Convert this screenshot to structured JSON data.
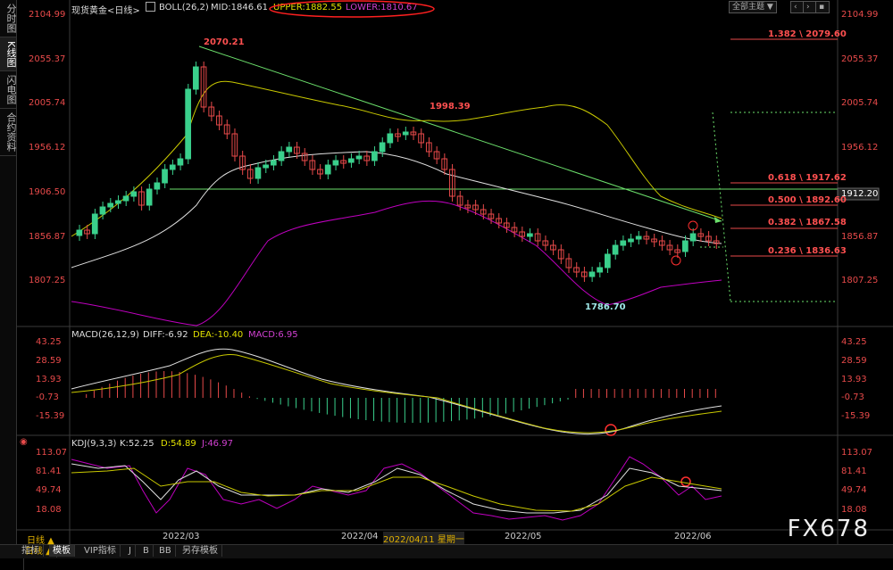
{
  "left_tabs": [
    "分时图",
    "K线图",
    "闪电图",
    "合约资料"
  ],
  "header": {
    "symbol": "现货黄金<日线>",
    "indicator": "BOLL(26,2)",
    "mid": "MID:1846.61",
    "upper": "UPPER:1882.55",
    "lower": "LOWER:1810.67",
    "theme_button": "全部主题",
    "theme_arrow": "▼"
  },
  "price_axis": [
    "2104.99",
    "2055.37",
    "2005.74",
    "1956.12",
    "1906.50",
    "1856.87",
    "1807.25"
  ],
  "current_price": "1912.20",
  "annotations": {
    "high": "2070.21",
    "mid_high": "1998.39",
    "low": "1786.70"
  },
  "fib_levels": [
    "1.382 \\ 2079.60",
    "0.618 \\ 1917.62",
    "0.500 \\ 1892.60",
    "0.382 \\ 1867.58",
    "0.236 \\ 1836.63"
  ],
  "macd": {
    "title": "MACD(26,12,9)",
    "diff": "DIFF:-6.92",
    "dea": "DEA:-10.40",
    "macd": "MACD:6.95",
    "axis": [
      "43.25",
      "28.59",
      "13.93",
      "-0.73",
      "-15.39"
    ]
  },
  "kdj": {
    "title": "KDJ(9,3,3)",
    "k": "K:52.25",
    "d": "D:54.89",
    "j": "J:46.97",
    "axis": [
      "113.07",
      "81.41",
      "49.74",
      "18.08"
    ]
  },
  "dates": [
    "2022/03",
    "2022/04",
    "2022/04/11 星期一",
    "2022/05",
    "2022/06"
  ],
  "bottom_tabs": [
    "日线 ▲",
    "指标",
    "模板",
    "VIP指标",
    "J",
    "B",
    "BB",
    "另存模板"
  ],
  "watermark": "FX678",
  "colors": {
    "up": "#3ad08c",
    "down": "#e84a4a",
    "mid": "#e0e0e0",
    "upper": "#c8c800",
    "lower": "#c000c0"
  }
}
